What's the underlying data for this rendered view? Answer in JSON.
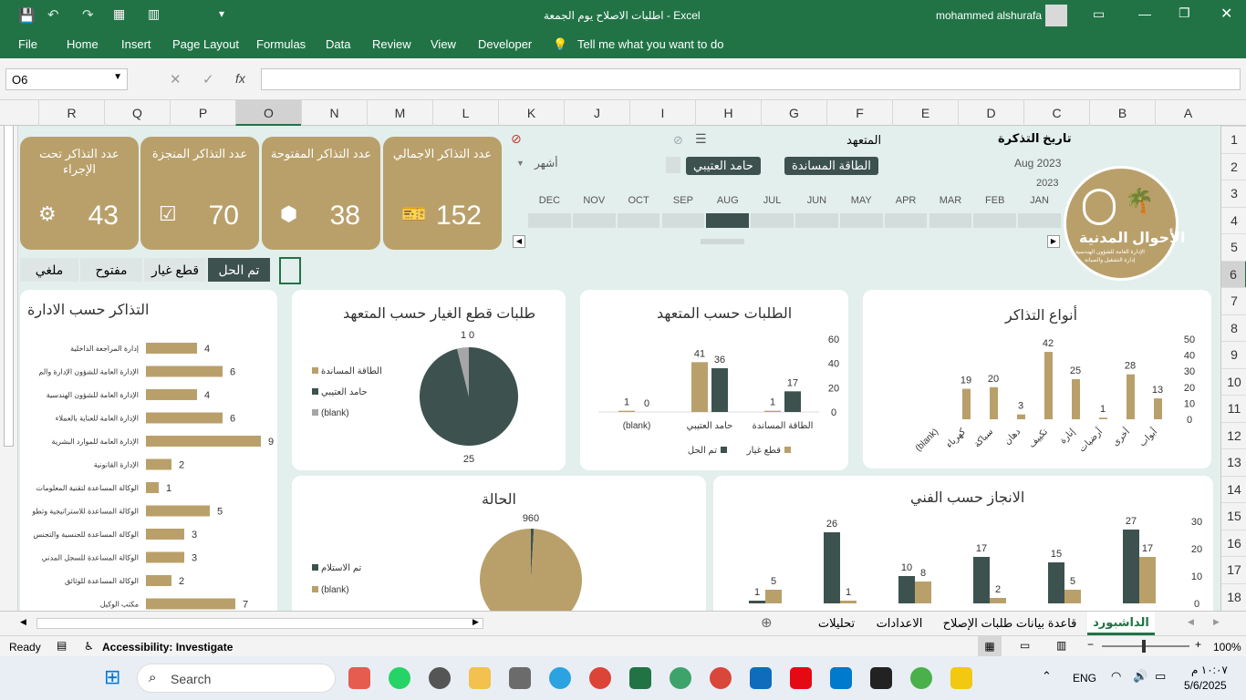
{
  "window": {
    "title": "اطلبات الاصلاح يوم الجمعة  -  Excel",
    "user": "mohammed alshurafa"
  },
  "menu": [
    "File",
    "Home",
    "Insert",
    "Page Layout",
    "Formulas",
    "Data",
    "Review",
    "View",
    "Developer"
  ],
  "tell_me": "Tell me what you want to do",
  "namebox": "O6",
  "columns": [
    "R",
    "Q",
    "P",
    "O",
    "N",
    "M",
    "L",
    "K",
    "J",
    "I",
    "H",
    "G",
    "F",
    "E",
    "D",
    "C",
    "B",
    "A"
  ],
  "rows": [
    "1",
    "2",
    "3",
    "4",
    "5",
    "6",
    "7",
    "8",
    "9",
    "10",
    "11",
    "12",
    "13",
    "14",
    "15",
    "16",
    "17",
    "18"
  ],
  "kpis": [
    {
      "label": "عدد التذاكر تحت الإجراء",
      "value": "43",
      "icon": "gear-icon"
    },
    {
      "label": "عدد التذاكر المنجزة",
      "value": "70",
      "icon": "checkbox-icon"
    },
    {
      "label": "عدد التذاكر المفتوحة",
      "value": "38",
      "icon": "box-icon"
    },
    {
      "label": "عدد التذاكر الاجمالي",
      "value": "152",
      "icon": "ticket-icon"
    }
  ],
  "status_tabs": [
    "تم الحل",
    "قطع غيار",
    "مفتوح",
    "ملغي"
  ],
  "slicer": {
    "date_title": "تاريخ التذكرة",
    "date_value": "Aug 2023",
    "year": "2023",
    "period": "أشهر",
    "months": [
      "JAN",
      "FEB",
      "MAR",
      "APR",
      "MAY",
      "JUN",
      "JUL",
      "AUG",
      "SEP",
      "OCT",
      "NOV",
      "DEC"
    ],
    "contractor_title": "المتعهد",
    "contractor_items": [
      "الطاقة المساندة",
      "حامد العتيبي"
    ]
  },
  "logo": {
    "name": "الأحوال المدنية",
    "sub1": "الإدارة العامة للشؤون الهندسية",
    "sub2": "إدارة التشغيل والصيانة"
  },
  "colors": {
    "gold": "#b9a06b",
    "dark": "#3d524f",
    "green": "#217346",
    "bg": "#e3efed"
  },
  "chart_data": [
    {
      "type": "bar",
      "title": "أنواع التذاكر",
      "categories": [
        "أبواب",
        "أخرى",
        "أرضيات",
        "إنارة",
        "تكييف",
        "دهان",
        "سباكة",
        "كهرباء",
        "(blank)"
      ],
      "values": [
        13,
        28,
        1,
        25,
        42,
        3,
        20,
        19,
        null
      ],
      "ylim": [
        0,
        50
      ],
      "yticks": [
        0,
        10,
        20,
        30,
        40,
        50
      ]
    },
    {
      "type": "bar",
      "title": "الطلبات حسب المتعهد",
      "categories": [
        "الطاقة المساندة",
        "حامد العتيبي",
        "(blank)"
      ],
      "series": [
        {
          "name": "قطع غيار",
          "values": [
            1,
            41,
            1
          ]
        },
        {
          "name": "تم الحل",
          "values": [
            17,
            36,
            0
          ]
        }
      ],
      "ylim": [
        0,
        60
      ],
      "yticks": [
        0,
        20,
        40,
        60
      ]
    },
    {
      "type": "pie",
      "title": "طلبات قطع الغيار حسب المتعهد",
      "labels": [
        "الطاقة المساندة",
        "حامد العتيبي",
        "(blank)"
      ],
      "values": [
        0,
        25,
        1
      ]
    },
    {
      "type": "bar",
      "title": "التذاكر حسب الادارة",
      "orientation": "horizontal",
      "categories": [
        "إدارة المراجعة الداخلية",
        "الإدارة العامة للشؤون الإدارة والمالية",
        "الإدارة العامة للشؤون الهندسية",
        "الإدارة العامة للعناية بالعملاء",
        "الإدارة العامة للموارد البشرية",
        "الإدارة القانونية",
        "الوكالة المساعدة لتقنية المعلومات والتحول الرقمي",
        "الوكالة المساعدة للاستراتيجية وتطوير الأعمال",
        "الوكالة المساعدة للجنسية والتجنس",
        "الوكالة المساعدة للسجل المدني",
        "الوكالة المساعدة للوثائق",
        "مكتب الوكيل"
      ],
      "values": [
        4,
        6,
        4,
        6,
        9,
        2,
        1,
        5,
        3,
        3,
        2,
        7
      ]
    },
    {
      "type": "pie",
      "title": "الحالة",
      "labels": [
        "تم الاستلام",
        "(blank)"
      ],
      "values": [
        9,
        960
      ]
    },
    {
      "type": "bar",
      "title": "الانجاز حسب الفني",
      "series": [
        {
          "name": "dark",
          "values": [
            27,
            15,
            17,
            10,
            26,
            1
          ]
        },
        {
          "name": "gold",
          "values": [
            17,
            5,
            2,
            8,
            1,
            5
          ]
        }
      ],
      "ylim": [
        0,
        30
      ],
      "yticks": [
        0,
        10,
        20,
        30
      ]
    }
  ],
  "sheet_tabs": [
    "الداشبورد",
    "قاعدة بيانات طلبات الإصلاح",
    "الاعدادات",
    "تحليلات"
  ],
  "status": {
    "ready": "Ready",
    "accessibility": "Accessibility: Investigate",
    "zoom": "100%"
  },
  "taskbar": {
    "search": "Search",
    "lang": "ENG",
    "time": "١٠:٠٧ م",
    "date": "5/6/2025"
  }
}
